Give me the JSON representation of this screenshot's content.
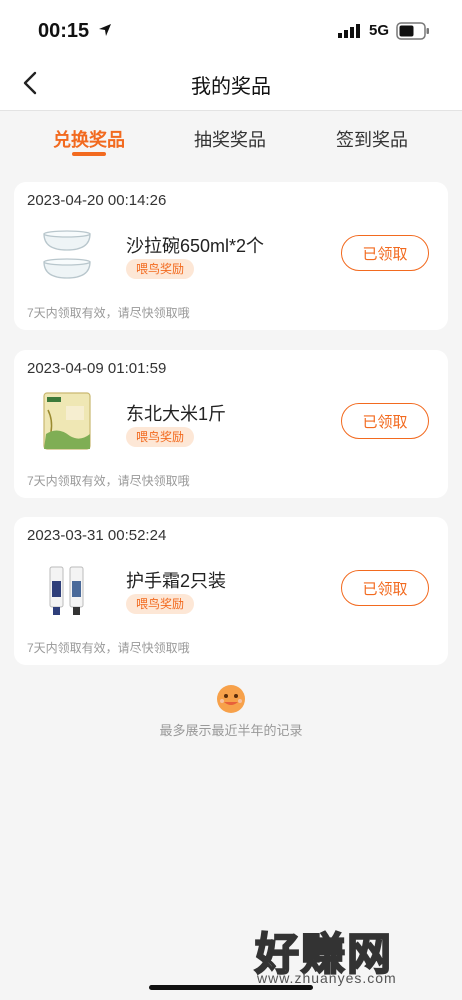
{
  "status_bar": {
    "time": "00:15",
    "network": "5G"
  },
  "nav": {
    "title": "我的奖品"
  },
  "tabs": [
    {
      "label": "兑换奖品",
      "active": true
    },
    {
      "label": "抽奖奖品",
      "active": false
    },
    {
      "label": "签到奖品",
      "active": false
    }
  ],
  "prizes": [
    {
      "date": "2023-04-20 00:14:26",
      "name": "沙拉碗650ml*2个",
      "tag": "喂鸟奖励",
      "button": "已领取",
      "note": "7天内领取有效，请尽快领取哦",
      "icon": "glass-bowls"
    },
    {
      "date": "2023-04-09 01:01:59",
      "name": "东北大米1斤",
      "tag": "喂鸟奖励",
      "button": "已领取",
      "note": "7天内领取有效，请尽快领取哦",
      "icon": "rice-bag"
    },
    {
      "date": "2023-03-31 00:52:24",
      "name": "护手霜2只装",
      "tag": "喂鸟奖励",
      "button": "已领取",
      "note": "7天内领取有效，请尽快领取哦",
      "icon": "hand-cream-tubes"
    }
  ],
  "footer": {
    "note": "最多展示最近半年的记录"
  },
  "watermark": {
    "main": "好赚网",
    "url": "www.zhuanyes.com"
  },
  "colors": {
    "accent": "#f26a1f",
    "tag_bg": "#fde7d6",
    "page_bg": "#f5f5f5"
  }
}
